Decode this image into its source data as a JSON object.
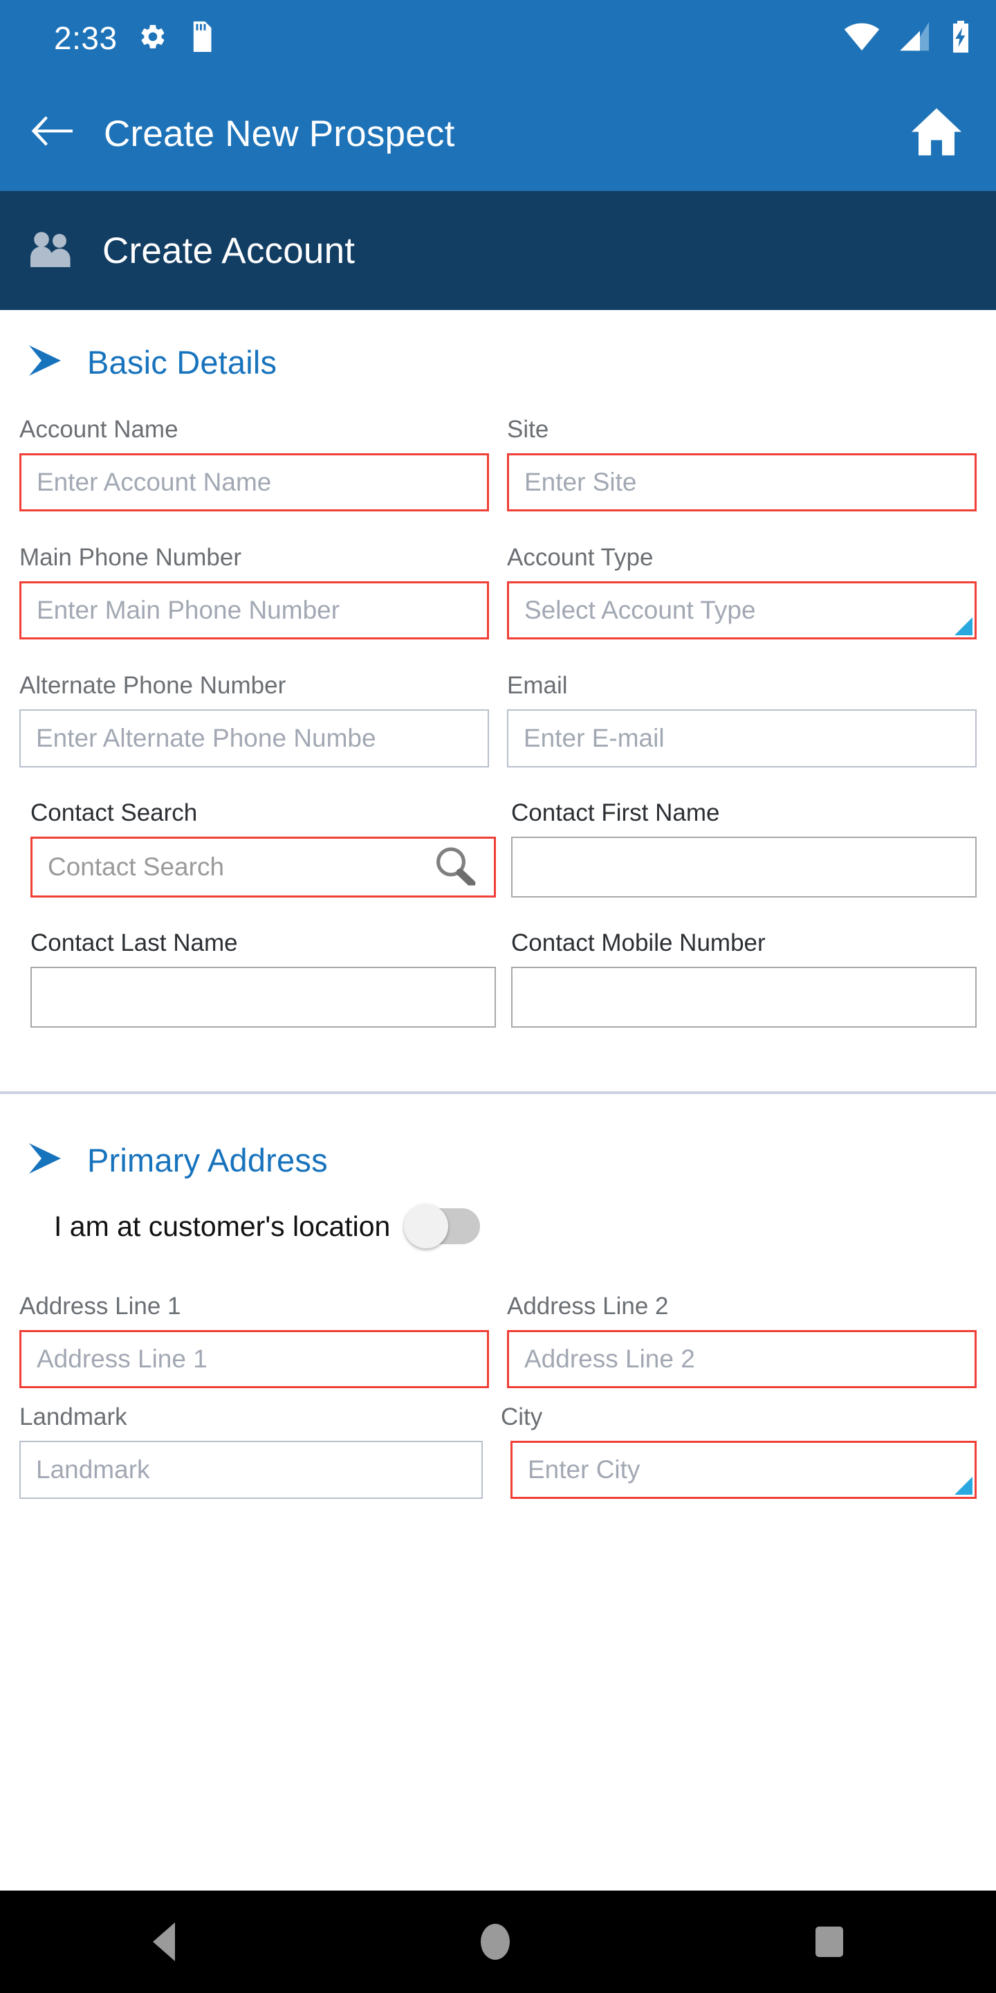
{
  "status_bar": {
    "time": "2:33",
    "icons_left": [
      "gear-icon",
      "sd-card-icon"
    ],
    "icons_right": [
      "wifi-icon",
      "cellular-signal-icon",
      "battery-charging-icon"
    ]
  },
  "app_bar": {
    "back_icon": "back-arrow-icon",
    "title": "Create New Prospect",
    "home_icon": "home-icon",
    "background_color": "#1e73b8"
  },
  "sub_header": {
    "icon": "people-group-icon",
    "title": "Create Account",
    "background_color": "#133e63"
  },
  "sections": [
    {
      "id": "basic-details",
      "title": "Basic Details",
      "chevron_icon": "chevron-right-icon",
      "accent_color": "#1873bd",
      "rows": [
        {
          "left": {
            "label": "Account Name",
            "placeholder": "Enter Account Name",
            "required": true,
            "value": "",
            "type": "text"
          },
          "right": {
            "label": "Site",
            "placeholder": "Enter Site",
            "required": true,
            "value": "",
            "type": "text"
          }
        },
        {
          "left": {
            "label": "Main Phone Number",
            "placeholder": "Enter Main Phone Number",
            "required": true,
            "value": "",
            "type": "text"
          },
          "right": {
            "label": "Account Type",
            "placeholder": "Select Account Type",
            "required": true,
            "value": "",
            "type": "dropdown"
          }
        },
        {
          "left": {
            "label": "Alternate Phone Number",
            "placeholder": "Enter Alternate Phone Numbe",
            "required": false,
            "value": "",
            "type": "text"
          },
          "right": {
            "label": "Email",
            "placeholder": "Enter E-mail",
            "required": false,
            "value": "",
            "type": "text"
          }
        },
        {
          "left": {
            "label": "Contact Search",
            "placeholder": "Contact Search",
            "required": true,
            "value": "",
            "type": "search",
            "label_dark": true
          },
          "right": {
            "label": "Contact First Name",
            "placeholder": "",
            "required": false,
            "value": "",
            "type": "text",
            "label_dark": true
          }
        },
        {
          "left": {
            "label": "Contact Last Name",
            "placeholder": "",
            "required": false,
            "value": "",
            "type": "text",
            "label_dark": true
          },
          "right": {
            "label": "Contact Mobile Number",
            "placeholder": "",
            "required": false,
            "value": "",
            "type": "text",
            "label_dark": true
          }
        }
      ]
    },
    {
      "id": "primary-address",
      "title": "Primary Address",
      "chevron_icon": "chevron-right-icon",
      "accent_color": "#1873bd",
      "toggle": {
        "label": "I am at customer's location",
        "state": "off"
      },
      "rows": [
        {
          "left": {
            "label": "Address Line 1",
            "placeholder": "Address Line 1",
            "required": true,
            "value": "",
            "type": "text"
          },
          "right": {
            "label": "Address Line 2",
            "placeholder": "Address Line 2",
            "required": true,
            "value": "",
            "type": "text"
          }
        },
        {
          "left": {
            "label": "Landmark",
            "placeholder": "Landmark",
            "required": false,
            "value": "",
            "type": "text"
          },
          "right": {
            "label": "City",
            "placeholder": "Enter City",
            "required": true,
            "value": "",
            "type": "dropdown"
          }
        }
      ]
    }
  ],
  "nav_bar": {
    "back_icon": "nav-back-triangle-icon",
    "home_icon": "nav-home-circle-icon",
    "recents_icon": "nav-recents-square-icon"
  },
  "colors": {
    "primary_blue": "#1e73b8",
    "dark_navy": "#133e63",
    "accent_blue": "#1873bd",
    "required_red": "#ef3f36",
    "field_border": "#b9bfcb",
    "placeholder": "#a2a8b3",
    "label_gray": "#6b6f73"
  }
}
